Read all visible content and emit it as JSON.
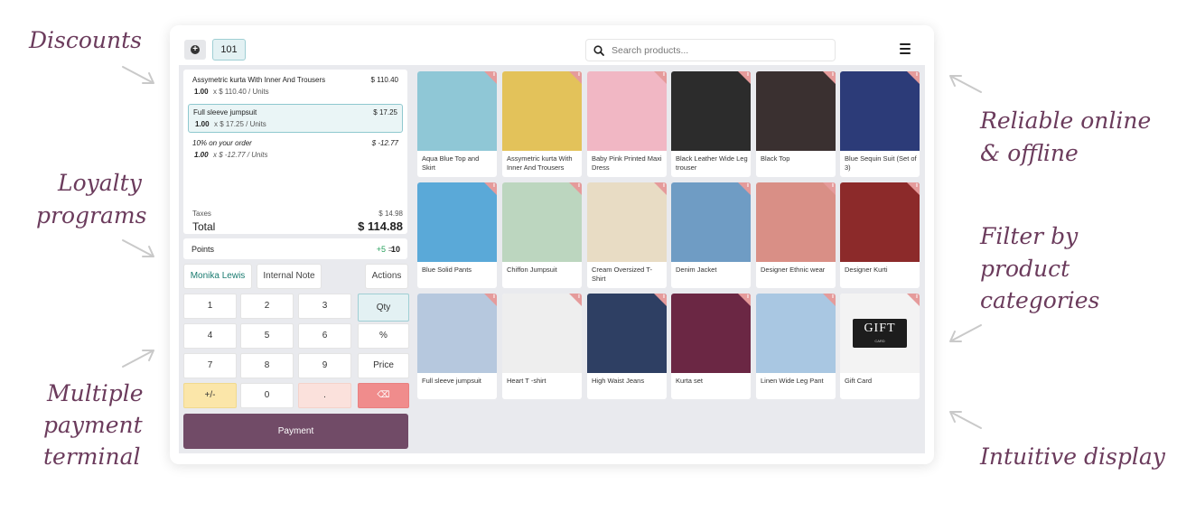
{
  "annotations": {
    "discounts": "Discounts",
    "loyalty_1": "Loyalty",
    "loyalty_2": "programs",
    "payment_1": "Multiple",
    "payment_2": "payment",
    "payment_3": "terminal",
    "reliable_1": "Reliable online",
    "reliable_2": "& offline",
    "filter_1": "Filter by",
    "filter_2": "product",
    "filter_3": "categories",
    "intuitive": "Intuitive display"
  },
  "header": {
    "order_tab": "101",
    "search_placeholder": "Search products..."
  },
  "order": {
    "lines": [
      {
        "name": "Assymetric kurta With Inner And Trousers",
        "price": "$ 110.40",
        "qty": "1.00",
        "unit": "x $ 110.40 / Units"
      },
      {
        "name": "Full sleeve jumpsuit",
        "price": "$ 17.25",
        "qty": "1.00",
        "unit": "x $ 17.25 / Units"
      },
      {
        "name": "10% on your order",
        "price": "$ -12.77",
        "qty": "1.00",
        "unit": "x $ -12.77 / Units"
      }
    ],
    "taxes_label": "Taxes",
    "taxes_value": "$ 14.98",
    "total_label": "Total",
    "total_value": "$ 114.88"
  },
  "points": {
    "label": "Points",
    "added": "+5",
    "equals": "=",
    "total": "10"
  },
  "actions": {
    "customer": "Monika Lewis",
    "note": "Internal Note",
    "actions": "Actions"
  },
  "numpad": {
    "k1": "1",
    "k2": "2",
    "k3": "3",
    "qty": "Qty",
    "k4": "4",
    "k5": "5",
    "k6": "6",
    "disc": "%",
    "k7": "7",
    "k8": "8",
    "k9": "9",
    "price": "Price",
    "sign": "+/-",
    "k0": "0",
    "dot": ".",
    "back": "⌫"
  },
  "payment_label": "Payment",
  "products": [
    {
      "name": "Aqua Blue Top and Skirt",
      "color": "#8fc7d6"
    },
    {
      "name": "Assymetric kurta With Inner And Trousers",
      "color": "#e3c25a"
    },
    {
      "name": "Baby Pink Printed Maxi Dress",
      "color": "#f1b7c4"
    },
    {
      "name": "Black Leather Wide Leg trouser",
      "color": "#2c2c2c"
    },
    {
      "name": "Black Top",
      "color": "#3a3030"
    },
    {
      "name": "Blue Sequin Suit (Set of 3)",
      "color": "#2c3b78"
    },
    {
      "name": "Blue Solid Pants",
      "color": "#5aa9d8"
    },
    {
      "name": "Chiffon Jumpsuit",
      "color": "#bcd6bf"
    },
    {
      "name": "Cream Oversized T-Shirt",
      "color": "#e8dcc4"
    },
    {
      "name": "Denim Jacket",
      "color": "#6f9cc4"
    },
    {
      "name": "Designer Ethnic wear",
      "color": "#d98f86"
    },
    {
      "name": "Designer Kurti",
      "color": "#8c2a2a"
    },
    {
      "name": "Full sleeve jumpsuit",
      "color": "#b6c8de"
    },
    {
      "name": "Heart T -shirt",
      "color": "#eeeeee"
    },
    {
      "name": "High Waist Jeans",
      "color": "#2e3f63"
    },
    {
      "name": "Kurta set",
      "color": "#6b2744"
    },
    {
      "name": "Linen Wide Leg Pant",
      "color": "#a9c7e2"
    },
    {
      "name": "Gift Card",
      "color": "#f3f3f3"
    }
  ],
  "gift_card": {
    "big": "GIFT",
    "small": "CARD"
  }
}
